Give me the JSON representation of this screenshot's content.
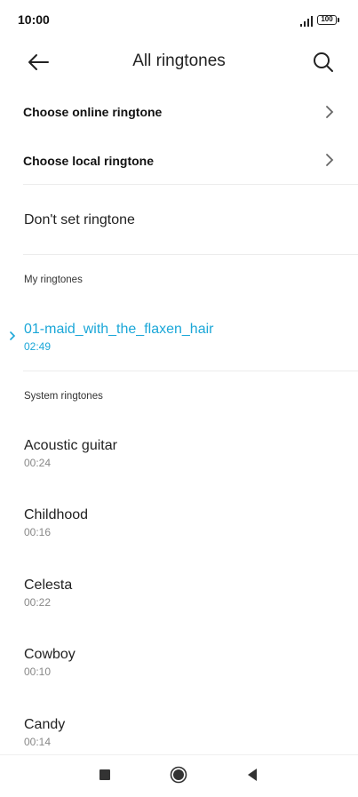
{
  "status_bar": {
    "time": "10:00",
    "battery": "100"
  },
  "header": {
    "title": "All ringtones"
  },
  "options": {
    "online": "Choose online ringtone",
    "local": "Choose local ringtone",
    "none": "Don't set ringtone"
  },
  "my_ringtones": {
    "heading": "My ringtones",
    "items": [
      {
        "name": "01-maid_with_the_flaxen_hair",
        "duration": "02:49",
        "selected": true
      }
    ]
  },
  "system_ringtones": {
    "heading": "System ringtones",
    "items": [
      {
        "name": "Acoustic guitar",
        "duration": "00:24"
      },
      {
        "name": "Childhood",
        "duration": "00:16"
      },
      {
        "name": "Celesta",
        "duration": "00:22"
      },
      {
        "name": "Cowboy",
        "duration": "00:10"
      },
      {
        "name": "Candy",
        "duration": "00:14"
      }
    ]
  },
  "colors": {
    "accent": "#1ba7d8"
  },
  "icons": [
    "back-arrow-icon",
    "search-icon",
    "chevron-right-icon",
    "selected-indicator-icon",
    "signal-icon",
    "battery-icon",
    "recents-icon",
    "home-icon",
    "back-triangle-icon"
  ]
}
